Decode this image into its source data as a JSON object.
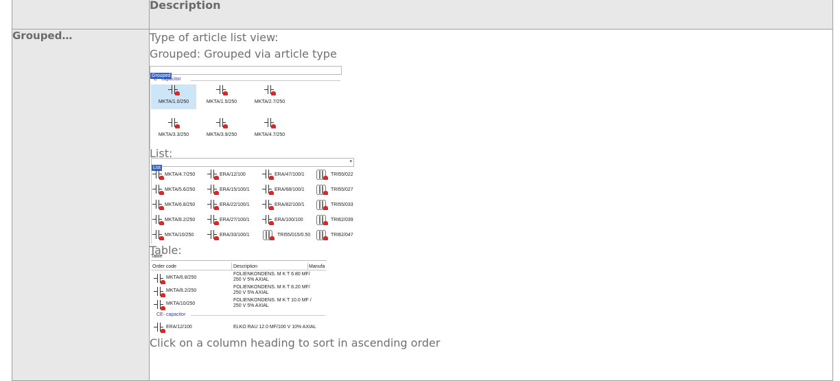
{
  "table": {
    "header": {
      "col1": "",
      "col2": "Description"
    },
    "row": {
      "key": "Grouped…",
      "lines": {
        "l1": "Type of article list view:",
        "l2": "Grouped: Grouped via article type",
        "list_label": "List:",
        "table_label": "Table:",
        "last": "Click on a column heading to sort in ascending order"
      }
    }
  },
  "grouped_shot": {
    "combo_value": "Grouped",
    "group_title": "C - capacitor",
    "items": [
      "MKTA/1.0/250",
      "MKTA/1.5/250",
      "MKTA/2.7/250",
      "MKTA/3.3/250",
      "MKTA/3.9/250",
      "MKTA/4.7/250"
    ]
  },
  "list_shot": {
    "combo_value": "List",
    "arrow": "▾",
    "items": [
      [
        "MKTA/4.7/250",
        "ERA/12/100",
        "ERA/47/100/1",
        "TRI55/022"
      ],
      [
        "MKTA/5.6/250",
        "ERA/15/100/1",
        "ERA/68/100/1",
        "TRI55/027"
      ],
      [
        "MKTA/6.8/250",
        "ERA/22/100/1",
        "ERA/82/100/1",
        "TRI55/033"
      ],
      [
        "MKTA/8.2/250",
        "ERA/27/100/1",
        "ERA/100/100",
        "TRI62/039"
      ],
      [
        "MKTA/10/250",
        "ERA/33/100/1",
        "TRI55/015/0.50",
        "TRI62/047"
      ]
    ]
  },
  "table_shot": {
    "combo_value": "Table",
    "headers": {
      "order_code": "Order code",
      "description": "Description",
      "manufacturer": "Manufa"
    },
    "rows": [
      {
        "code": "MKTA/6.8/250",
        "desc1": "FOLIENKONDENS. M K T 6.80 MF/",
        "desc2": "250 V 5% AXIAL"
      },
      {
        "code": "MKTA/8.2/250",
        "desc1": "FOLIENKONDENS. M K T 8.20 MF/",
        "desc2": "250 V 5% AXIAL"
      },
      {
        "code": "MKTA/10/250",
        "desc1": "FOLIENKONDENS. M K T 10.0 MF /",
        "desc2": "250 V 5% AXIAL"
      }
    ],
    "group2_title": "CE- capacitor",
    "row4": {
      "code": "ERA/12/100",
      "desc": "ELKO RAU 12.0 MF/100 V 10% AXIAL"
    }
  },
  "colors": {
    "header_bg": "#e8e8e8",
    "border": "#9e9e9e",
    "text": "#6f6f6f",
    "selection": "#3b63b6",
    "icon_red": "#d42a2a",
    "group_title": "#3a3a9a"
  }
}
